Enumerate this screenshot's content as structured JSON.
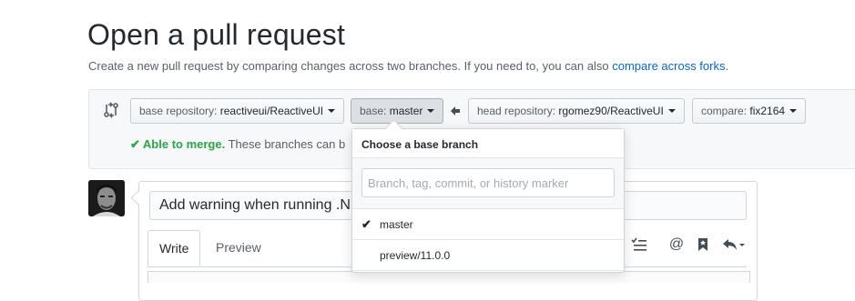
{
  "page": {
    "title": "Open a pull request",
    "subtitle_text": "Create a new pull request by comparing changes across two branches. If you need to, you can also ",
    "subtitle_link": "compare across forks",
    "subtitle_end": "."
  },
  "range": {
    "base_repo_label": "base repository: ",
    "base_repo_value": "reactiveui/ReactiveUI",
    "base_label": "base: ",
    "base_value": "master",
    "head_repo_label": "head repository: ",
    "head_repo_value": "rgomez90/ReactiveUI",
    "compare_label": "compare: ",
    "compare_value": "fix2164",
    "merge_ok": "Able to merge.",
    "merge_text": " These branches can b"
  },
  "dropdown": {
    "header": "Choose a base branch",
    "filter_placeholder": "Branch, tag, commit, or history marker",
    "items": [
      {
        "label": "master",
        "selected": true
      },
      {
        "label": "preview/11.0.0",
        "selected": false
      }
    ]
  },
  "comment": {
    "title_value": "Add warning when running .NET Core",
    "tab_write": "Write",
    "tab_preview": "Preview",
    "icons": [
      "tasklist-icon",
      "mention-icon",
      "bookmark-icon",
      "reply-icon"
    ]
  },
  "colors": {
    "link": "#0366d6",
    "success": "#28a745",
    "text": "#24292e",
    "muted": "#586069"
  }
}
